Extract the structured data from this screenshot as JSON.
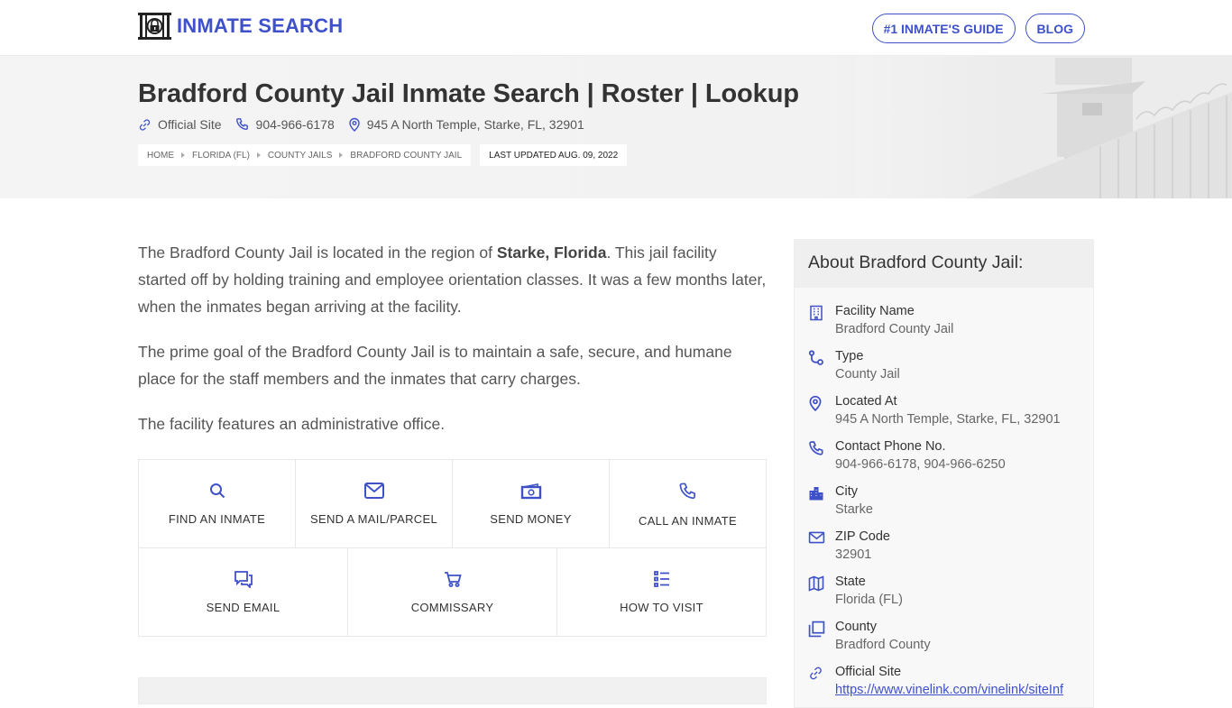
{
  "brand": {
    "name": "INMATE SEARCH",
    "icon": "jail-lock-icon",
    "color": "#3f51c9"
  },
  "nav": {
    "buttons": [
      {
        "label": "#1 INMATE'S GUIDE"
      },
      {
        "label": "BLOG"
      }
    ]
  },
  "hero": {
    "title": "Bradford County Jail Inmate Search | Roster | Lookup",
    "meta": {
      "official_site": "Official Site",
      "phone": "904-966-6178",
      "address": "945 A North Temple, Starke, FL, 32901"
    },
    "breadcrumbs": [
      "HOME",
      "FLORIDA (FL)",
      "COUNTY JAILS",
      "BRADFORD COUNTY JAIL"
    ],
    "last_updated": "LAST UPDATED AUG. 09, 2022"
  },
  "content": {
    "p1_before": "The Bradford County Jail is located in the region of ",
    "p1_bold": "Starke, Florida",
    "p1_after": ". This jail facility started off by holding training and employee orientation classes. It was a few months later, when the inmates began arriving at the facility.",
    "p2": "The prime goal of the Bradford County Jail is to maintain a safe, secure, and humane place for the staff members and the inmates that carry charges.",
    "p3": "The facility features an administrative office."
  },
  "actions": {
    "row1": [
      {
        "label": "FIND AN INMATE",
        "icon": "search-icon"
      },
      {
        "label": "SEND A MAIL/PARCEL",
        "icon": "mail-icon"
      },
      {
        "label": "SEND MONEY",
        "icon": "money-icon"
      },
      {
        "label": "CALL AN INMATE",
        "icon": "phone-icon"
      }
    ],
    "row2": [
      {
        "label": "SEND EMAIL",
        "icon": "chat-icon"
      },
      {
        "label": "COMMISSARY",
        "icon": "cart-icon"
      },
      {
        "label": "HOW TO VISIT",
        "icon": "list-icon"
      }
    ]
  },
  "sidebar": {
    "title": "About Bradford County Jail:",
    "items": [
      {
        "label": "Facility Name",
        "value": "Bradford County Jail",
        "icon": "building-icon"
      },
      {
        "label": "Type",
        "value": "County Jail",
        "icon": "route-icon"
      },
      {
        "label": "Located At",
        "value": "945 A North Temple, Starke, FL, 32901",
        "icon": "map-pin-icon"
      },
      {
        "label": "Contact Phone No.",
        "value": "904-966-6178, 904-966-6250",
        "icon": "phone-icon"
      },
      {
        "label": "City",
        "value": "Starke",
        "icon": "city-icon"
      },
      {
        "label": "ZIP Code",
        "value": "32901",
        "icon": "mail-icon"
      },
      {
        "label": "State",
        "value": "Florida (FL)",
        "icon": "map-icon"
      },
      {
        "label": "County",
        "value": "Bradford County",
        "icon": "copy-icon"
      },
      {
        "label": "Official Site",
        "value": "https://www.vinelink.com/vinelink/siteInf",
        "icon": "link-icon"
      }
    ]
  }
}
